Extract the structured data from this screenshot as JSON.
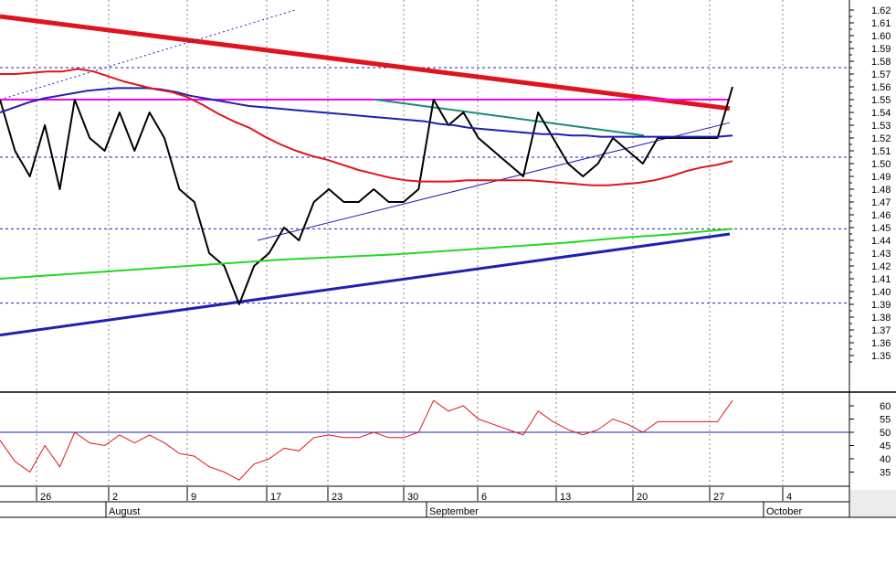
{
  "chart_data": [
    {
      "type": "line",
      "panel": "price",
      "ylim": [
        1.34,
        1.625
      ],
      "yticks": [
        "1.62",
        "1.61",
        "1.60",
        "1.59",
        "1.58",
        "1.57",
        "1.56",
        "1.55",
        "1.54",
        "1.53",
        "1.52",
        "1.51",
        "1.50",
        "1.49",
        "1.48",
        "1.47",
        "1.46",
        "1.45",
        "1.44",
        "1.43",
        "1.42",
        "1.41",
        "1.40",
        "1.39",
        "1.38",
        "1.37",
        "1.36",
        "1.35"
      ],
      "horizontal_dashed_levels": [
        1.575,
        1.505,
        1.449,
        1.391
      ],
      "x": [
        0,
        1,
        2,
        3,
        4,
        5,
        6,
        7,
        8,
        9,
        10,
        11,
        12,
        13,
        14,
        15,
        16,
        17,
        18,
        19,
        20,
        21,
        22,
        23,
        24,
        25,
        26,
        27,
        28,
        29,
        30,
        31,
        32,
        33,
        34,
        35,
        36,
        37,
        38,
        39,
        40,
        41,
        42,
        43,
        44,
        45,
        46,
        47,
        48,
        49,
        50,
        51,
        52,
        53,
        54,
        55,
        56,
        57,
        58,
        59,
        60,
        61,
        62,
        63,
        64,
        65,
        66,
        67,
        68
      ],
      "series": [
        {
          "name": "",
          "color": "#000000",
          "width": 2,
          "values": [
            1.55,
            1.51,
            1.49,
            1.53,
            1.48,
            1.55,
            1.52,
            1.51,
            1.54,
            1.51,
            1.54,
            1.52,
            1.48,
            1.47,
            1.43,
            1.42,
            1.39,
            1.42,
            1.43,
            1.45,
            1.44,
            1.47,
            1.48,
            1.47,
            1.47,
            1.48,
            1.47,
            1.47,
            1.48,
            1.55,
            1.53,
            1.54,
            1.52,
            1.51,
            1.5,
            1.49,
            1.54,
            1.52,
            1.5,
            1.49,
            1.5,
            1.52,
            1.51,
            1.5,
            1.52,
            1.52,
            1.52,
            1.52,
            1.52,
            1.56
          ]
        },
        {
          "name": "",
          "color": "#1f1fb4",
          "width": 2,
          "values": [
            1.54,
            1.544,
            1.548,
            1.551,
            1.553,
            1.555,
            1.557,
            1.558,
            1.559,
            1.559,
            1.559,
            1.558,
            1.556,
            1.553,
            1.551,
            1.549,
            1.547,
            1.545,
            1.544,
            1.543,
            1.542,
            1.541,
            1.54,
            1.539,
            1.538,
            1.537,
            1.536,
            1.535,
            1.534,
            1.533,
            1.531,
            1.53,
            1.528,
            1.527,
            1.526,
            1.525,
            1.524,
            1.523,
            1.523,
            1.522,
            1.522,
            1.521,
            1.521,
            1.521,
            1.521,
            1.521,
            1.521,
            1.521,
            1.521,
            1.521,
            1.522
          ]
        },
        {
          "name": "",
          "color": "#e0141e",
          "width": 2,
          "values": [
            1.57,
            1.57,
            1.571,
            1.572,
            1.572,
            1.574,
            1.572,
            1.568,
            1.564,
            1.561,
            1.558,
            1.556,
            1.552,
            1.546,
            1.539,
            1.533,
            1.528,
            1.521,
            1.515,
            1.51,
            1.506,
            1.503,
            1.499,
            1.495,
            1.492,
            1.489,
            1.487,
            1.486,
            1.486,
            1.486,
            1.487,
            1.487,
            1.487,
            1.487,
            1.487,
            1.486,
            1.485,
            1.484,
            1.483,
            1.483,
            1.484,
            1.485,
            1.487,
            1.49,
            1.494,
            1.497,
            1.499,
            1.502
          ]
        },
        {
          "name": "",
          "color": "#22d822",
          "width": 2,
          "values": [
            1.41,
            1.413,
            1.416,
            1.419,
            1.422,
            1.425,
            1.427,
            1.429,
            1.432,
            1.435,
            1.438,
            1.442,
            1.445,
            1.449
          ]
        }
      ],
      "trendlines": [
        {
          "color": "#e0141e",
          "width": 5,
          "from": [
            0,
            1.615
          ],
          "to": [
            68,
            1.543
          ]
        },
        {
          "color": "#1f1fb4",
          "width": 3,
          "from": [
            0,
            1.366
          ],
          "to": [
            68,
            1.445
          ]
        },
        {
          "color": "#1f1fb4",
          "width": 1,
          "from": [
            24,
            1.44
          ],
          "to": [
            68,
            1.532
          ]
        },
        {
          "color": "#1f1fb4",
          "width": 1,
          "dashed": true,
          "from": [
            0,
            1.55
          ],
          "to": [
            27.5,
            1.62
          ]
        },
        {
          "color": "#ff00ff",
          "width": 2,
          "from": [
            0,
            1.55
          ],
          "to": [
            68,
            1.55
          ]
        },
        {
          "color": "#168c7c",
          "width": 2,
          "from": [
            35,
            1.55
          ],
          "to": [
            60,
            1.522
          ]
        }
      ]
    },
    {
      "type": "line",
      "panel": "oscillator",
      "ylim": [
        30,
        65
      ],
      "yticks": [
        "60",
        "55",
        "50",
        "45",
        "40",
        "35"
      ],
      "reference_level": 50,
      "x": [
        0,
        1,
        2,
        3,
        4,
        5,
        6,
        7,
        8,
        9,
        10,
        11,
        12,
        13,
        14,
        15,
        16,
        17,
        18,
        19,
        20,
        21,
        22,
        23,
        24,
        25,
        26,
        27,
        28,
        29,
        30,
        31,
        32,
        33,
        34,
        35,
        36,
        37,
        38,
        39,
        40,
        41,
        42,
        43,
        44,
        45,
        46,
        47,
        48,
        49,
        50,
        51,
        52,
        53,
        54,
        55,
        56,
        57,
        58
      ],
      "series": [
        {
          "name": "",
          "color": "#e0141e",
          "width": 1,
          "values": [
            47,
            39,
            35,
            45,
            37,
            50,
            46,
            45,
            49,
            46,
            49,
            46,
            42,
            41,
            37,
            35,
            32,
            38,
            40,
            44,
            43,
            48,
            49,
            48,
            48,
            50,
            48,
            48,
            50,
            62,
            58,
            60,
            55,
            53,
            51,
            49,
            58,
            54,
            51,
            49,
            51,
            55,
            53,
            50,
            54,
            54,
            54,
            54,
            54,
            62
          ]
        }
      ]
    }
  ],
  "x_axis": {
    "day_ticks": [
      "26",
      "2",
      "9",
      "17",
      "23",
      "30",
      "6",
      "13",
      "20",
      "27",
      "4"
    ],
    "month_labels": [
      "August",
      "September",
      "October"
    ]
  }
}
